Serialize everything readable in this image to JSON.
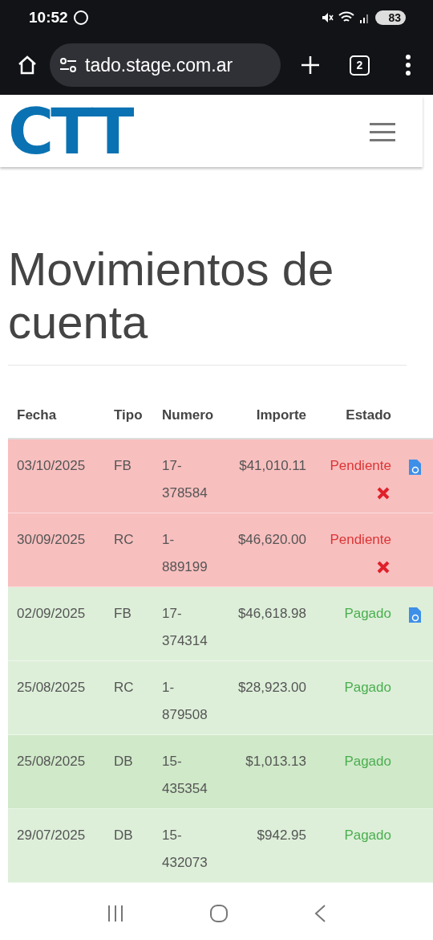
{
  "status_bar": {
    "time": "10:52",
    "battery": "83"
  },
  "browser": {
    "url": "tado.stage.com.ar",
    "tab_count": "2"
  },
  "header": {
    "logo": "CTT"
  },
  "page": {
    "title": "Movimientos de cuenta"
  },
  "table": {
    "columns": [
      "Fecha",
      "Tipo",
      "Numero",
      "Importe",
      "Estado"
    ],
    "rows": [
      {
        "date": "03/10/2025",
        "type": "FB",
        "number": "17-378584",
        "amount": "$41,010.11",
        "status": "Pendiente",
        "kind": "pending",
        "invoice": true,
        "cancel": true,
        "selected": false
      },
      {
        "date": "30/09/2025",
        "type": "RC",
        "number": "1-889199",
        "amount": "$46,620.00",
        "status": "Pendiente",
        "kind": "pending",
        "invoice": false,
        "cancel": true,
        "selected": false
      },
      {
        "date": "02/09/2025",
        "type": "FB",
        "number": "17-374314",
        "amount": "$46,618.98",
        "status": "Pagado",
        "kind": "paid",
        "invoice": true,
        "cancel": false,
        "selected": false
      },
      {
        "date": "25/08/2025",
        "type": "RC",
        "number": "1-879508",
        "amount": "$28,923.00",
        "status": "Pagado",
        "kind": "paid",
        "invoice": false,
        "cancel": false,
        "selected": false
      },
      {
        "date": "25/08/2025",
        "type": "DB",
        "number": "15-435354",
        "amount": "$1,013.13",
        "status": "Pagado",
        "kind": "paid",
        "invoice": false,
        "cancel": false,
        "selected": true
      },
      {
        "date": "29/07/2025",
        "type": "DB",
        "number": "15-432073",
        "amount": "$942.95",
        "status": "Pagado",
        "kind": "paid",
        "invoice": false,
        "cancel": false,
        "selected": false
      }
    ]
  }
}
